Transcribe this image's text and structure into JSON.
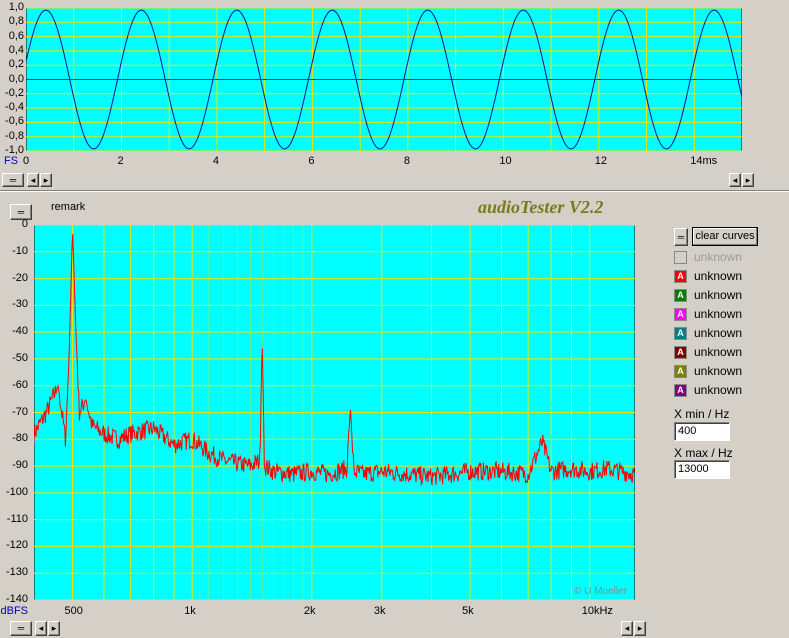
{
  "app_title": "audioTester V2.2",
  "remark": "remark",
  "copyright": "© U Mueller",
  "colors": {
    "plot_bg": "#00ffff",
    "grid": "#e6e600",
    "wave": "#1010a0",
    "spectrum": "#ff0000"
  },
  "waveform": {
    "y_unit": "FS",
    "x_ticks": [
      "0",
      "2",
      "4",
      "6",
      "8",
      "10",
      "12",
      "14ms"
    ],
    "y_ticks": [
      "1,0",
      "0,8",
      "0,6",
      "0,4",
      "0,2",
      "0,0",
      "-0,2",
      "-0,4",
      "-0,6",
      "-0,8",
      "-1,0"
    ]
  },
  "spectrum": {
    "y_unit": "dBFS",
    "x_ticks": [
      "500",
      "1k",
      "2k",
      "3k",
      "5k",
      "10kHz"
    ],
    "y_ticks": [
      "0",
      "-10",
      "-20",
      "-30",
      "-40",
      "-50",
      "-60",
      "-70",
      "-80",
      "-90",
      "-100",
      "-110",
      "-120",
      "-130",
      "-140"
    ]
  },
  "legend": {
    "clear_label": "clear curves",
    "items": [
      {
        "label": "unknown",
        "color": "#d4d0c8",
        "glyph": "",
        "disabled": true
      },
      {
        "label": "unknown",
        "color": "#ff0000",
        "glyph": "A"
      },
      {
        "label": "unknown",
        "color": "#008000",
        "glyph": "A"
      },
      {
        "label": "unknown",
        "color": "#ff00ff",
        "glyph": "A"
      },
      {
        "label": "unknown",
        "color": "#008080",
        "glyph": "A"
      },
      {
        "label": "unknown",
        "color": "#800000",
        "glyph": "A"
      },
      {
        "label": "unknown",
        "color": "#808000",
        "glyph": "A"
      },
      {
        "label": "unknown",
        "color": "#800080",
        "glyph": "A"
      }
    ]
  },
  "xmin_label": "X min / Hz",
  "xmin_value": "400",
  "xmax_label": "X max / Hz",
  "xmax_value": "13000",
  "chart_data": [
    {
      "type": "line",
      "xlabel": "ms",
      "ylabel": "FS",
      "xlim": [
        0,
        15
      ],
      "ylim": [
        -1.0,
        1.0
      ],
      "grid": true,
      "series": [
        {
          "frequency_hz": 500,
          "amplitude": 0.97,
          "phase_deg": 15
        }
      ]
    },
    {
      "type": "line",
      "xlabel": "Hz",
      "ylabel": "dBFS",
      "x_scale": "log",
      "xlim": [
        400,
        13000
      ],
      "ylim": [
        -140,
        0
      ],
      "grid": true,
      "series": [
        {
          "x": [
            400,
            430,
            460,
            480,
            490,
            500,
            510,
            520,
            540,
            560,
            600,
            650,
            700,
            800,
            900,
            1000,
            1100,
            1200,
            1400,
            1480,
            1500,
            1520,
            1600,
            1800,
            2000,
            2200,
            2450,
            2500,
            2550,
            2700,
            3000,
            3500,
            4000,
            4500,
            5000,
            6000,
            7000,
            7600,
            8000,
            9000,
            10000,
            11000,
            12000,
            13000
          ],
          "y": [
            -78,
            -70,
            -60,
            -80,
            -50,
            -1,
            -40,
            -70,
            -65,
            -75,
            -78,
            -80,
            -78,
            -76,
            -82,
            -80,
            -85,
            -88,
            -90,
            -88,
            -42,
            -90,
            -92,
            -93,
            -92,
            -93,
            -91,
            -68,
            -92,
            -93,
            -92,
            -93,
            -94,
            -93,
            -92,
            -92,
            -93,
            -81,
            -92,
            -91,
            -92,
            -91,
            -92,
            -93
          ]
        }
      ]
    }
  ]
}
